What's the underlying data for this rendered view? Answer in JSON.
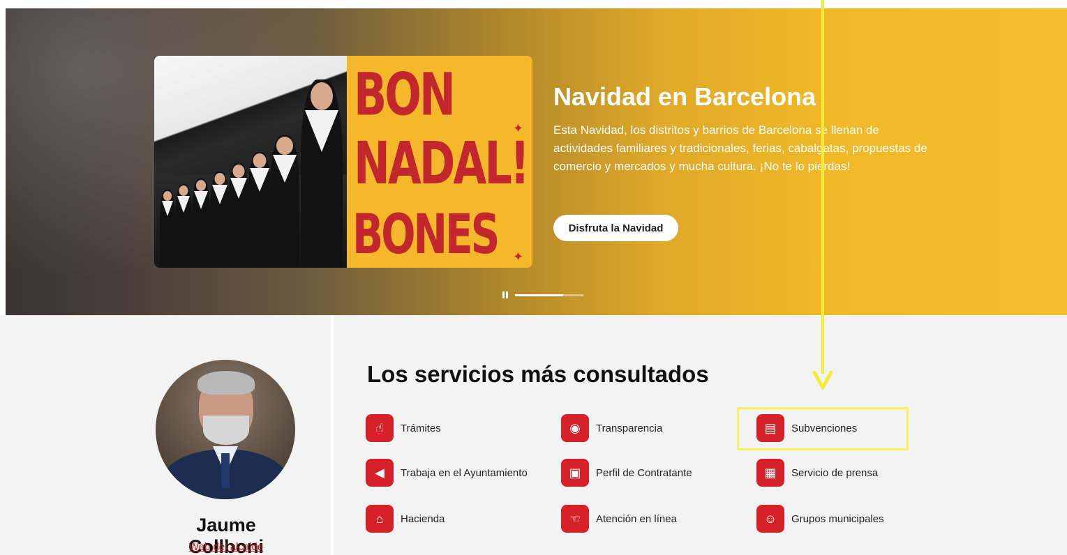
{
  "hero": {
    "poster_line1": "BON NADAL!",
    "poster_line2": "BONES FESTES!",
    "title": "Navidad en Barcelona",
    "description": "Esta Navidad, los distritos y barrios de Barcelona se llenan de actividades familiares y tradicionales, ferias, cabalgatas, propuestas de comercio y mercados y mucha cultura. ¡No te lo pierdas!",
    "button_label": "Disfruta la Navidad",
    "slide_progress": 0.7
  },
  "mayor": {
    "name": "Jaume Collboni",
    "link": "Web del alcalde"
  },
  "services": {
    "title": "Los servicios más consultados",
    "items": [
      {
        "label": "Trámites",
        "icon": "tramites-icon"
      },
      {
        "label": "Transparencia",
        "icon": "transparency-icon"
      },
      {
        "label": "Subvenciones",
        "icon": "grants-icon"
      },
      {
        "label": "Trabaja en el Ayuntamiento",
        "icon": "megaphone-icon"
      },
      {
        "label": "Perfil de Contratante",
        "icon": "briefcase-icon"
      },
      {
        "label": "Servicio de prensa",
        "icon": "newspaper-icon"
      },
      {
        "label": "Hacienda",
        "icon": "bank-icon"
      },
      {
        "label": "Atención en línea",
        "icon": "chat-hand-icon"
      },
      {
        "label": "Grupos municipales",
        "icon": "people-icon"
      }
    ]
  },
  "colors": {
    "accent_red": "#d6202a",
    "hero_yellow": "#f4be2c",
    "annotation_yellow": "#f2ee38"
  }
}
